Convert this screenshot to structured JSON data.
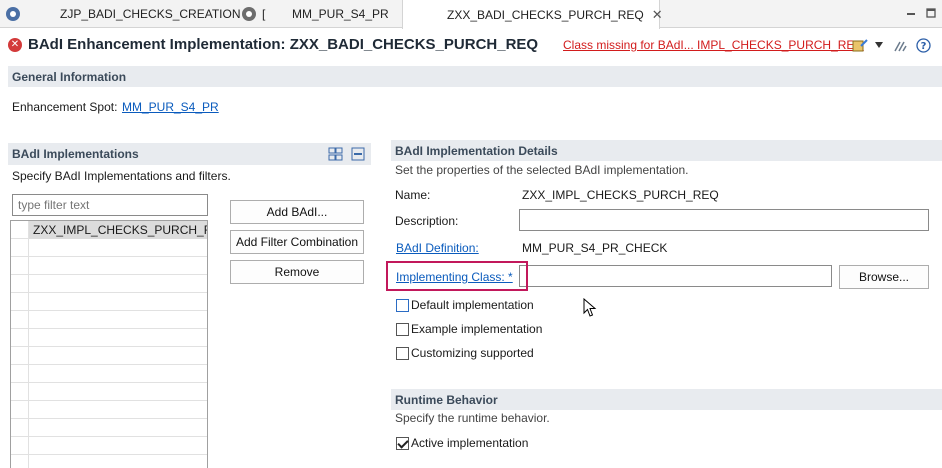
{
  "tabs": [
    {
      "label": "ZJP_BADI_CHECKS_CREATION",
      "icon": "enhancement-icon"
    },
    {
      "label": "[",
      "icon": "class-icon"
    },
    {
      "label": "MM_PUR_S4_PR",
      "icon": ""
    },
    {
      "label": "ZXX_BADI_CHECKS_PURCH_REQ",
      "icon": "badi-impl-icon",
      "active": true
    }
  ],
  "header": {
    "title": "BAdI Enhancement Implementation: ZXX_BADI_CHECKS_PURCH_REQ",
    "error_link": "Class missing for BAdI... IMPL_CHECKS_PURCH_REQ"
  },
  "general": {
    "heading": "General Information",
    "spot_label": "Enhancement Spot:",
    "spot_value": "MM_PUR_S4_PR"
  },
  "implementations": {
    "heading": "BAdI Implementations",
    "description": "Specify BAdI Implementations and filters.",
    "filter_placeholder": "type filter text",
    "rows": [
      "ZXX_IMPL_CHECKS_PURCH_REQ"
    ],
    "add_button": "Add BAdI...",
    "add_filter_button": "Add Filter Combination",
    "remove_button": "Remove"
  },
  "details": {
    "heading": "BAdI Implementation Details",
    "description": "Set the properties of the selected BAdI implementation.",
    "name_label": "Name:",
    "name_value": "ZXX_IMPL_CHECKS_PURCH_REQ",
    "desc_label": "Description:",
    "desc_value": "",
    "definition_label": "BAdI Definition:",
    "definition_value": "MM_PUR_S4_PR_CHECK",
    "class_label": "Implementing Class: *",
    "class_value": "",
    "browse_button": "Browse...",
    "default_impl": "Default implementation",
    "example_impl": "Example implementation",
    "customizing": "Customizing supported"
  },
  "runtime": {
    "heading": "Runtime Behavior",
    "description": "Specify the runtime behavior.",
    "active_impl": "Active implementation"
  },
  "colors": {
    "highlight": "#c2185b",
    "link": "#0a5bbd",
    "error": "#d21c1c"
  }
}
